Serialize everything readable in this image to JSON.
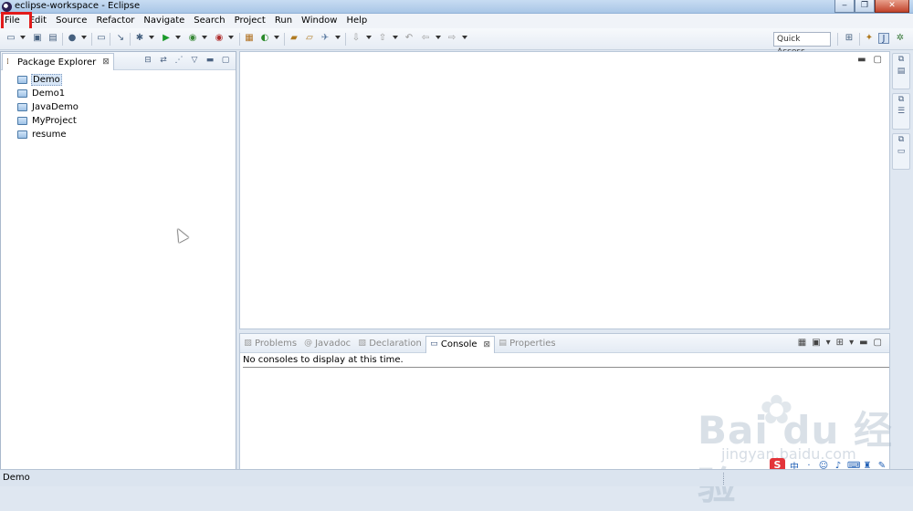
{
  "window": {
    "title": "eclipse-workspace - Eclipse"
  },
  "menu": [
    "File",
    "Edit",
    "Source",
    "Refactor",
    "Navigate",
    "Search",
    "Project",
    "Run",
    "Window",
    "Help"
  ],
  "toolbar": {
    "quick_access": "Quick Access"
  },
  "package_explorer": {
    "tab_label": "Package Explorer",
    "close_glyph": "⊠",
    "projects": [
      "Demo",
      "Demo1",
      "JavaDemo",
      "MyProject",
      "resume"
    ],
    "selected": "Demo"
  },
  "console_panel": {
    "tabs": [
      {
        "label": "Problems",
        "active": false
      },
      {
        "label": "Javadoc",
        "active": false
      },
      {
        "label": "Declaration",
        "active": false
      },
      {
        "label": "Console",
        "active": true
      },
      {
        "label": "Properties",
        "active": false
      }
    ],
    "message": "No consoles to display at this time."
  },
  "status": {
    "text": "Demo"
  },
  "watermark": {
    "brand": "Bai  du 经验",
    "sub": "jingyan.baidu.com"
  },
  "ime": {
    "logo": "S",
    "mode": "中"
  },
  "colors": {
    "highlight_box": "#e21a1a",
    "selection_bg": "#d7e6f7"
  }
}
